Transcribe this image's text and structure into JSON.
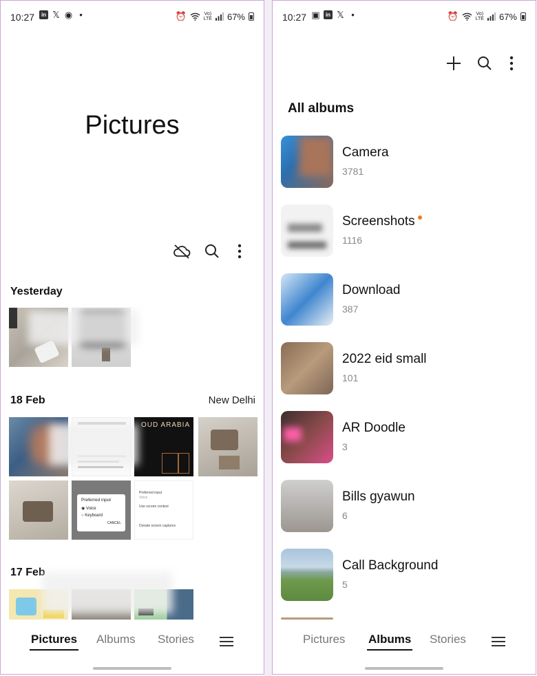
{
  "status_bar": {
    "time": "10:27",
    "battery": "67%",
    "network": "Vo) LTE"
  },
  "left_screen": {
    "title": "Pictures",
    "toolbar_icons": [
      "cloud-off-icon",
      "search-icon",
      "more-vert-icon"
    ],
    "sections": [
      {
        "date": "Yesterday",
        "location": ""
      },
      {
        "date": "18 Feb",
        "location": "New Delhi"
      },
      {
        "date": "17 Feb",
        "location": ""
      }
    ],
    "dialog": {
      "title": "Preferred input",
      "options": [
        "Voice",
        "Keyboard"
      ],
      "cancel": "CANCEL"
    },
    "settings_snippet": {
      "title": "Preferred input",
      "subtitle": "Voice",
      "item1": "Use screen context",
      "item2": "Donate screen captures"
    },
    "oud_text": "OUD ARABIA"
  },
  "right_screen": {
    "toolbar_icons": [
      "add-icon",
      "search-icon",
      "more-vert-icon"
    ],
    "heading": "All albums",
    "albums": [
      {
        "name": "Camera",
        "count": "3781"
      },
      {
        "name": "Screenshots",
        "count": "1116",
        "new_dot": true
      },
      {
        "name": "Download",
        "count": "387"
      },
      {
        "name": "2022 eid small",
        "count": "101"
      },
      {
        "name": "AR Doodle",
        "count": "3"
      },
      {
        "name": "Bills gyawun",
        "count": "6"
      },
      {
        "name": "Call Background",
        "count": "5"
      }
    ]
  },
  "bottom_nav": {
    "items": [
      "Pictures",
      "Albums",
      "Stories"
    ],
    "left_active": "Pictures",
    "right_active": "Albums"
  },
  "colors": {
    "accent_dot": "#f07b1d",
    "frame": "#c9a6d8"
  }
}
